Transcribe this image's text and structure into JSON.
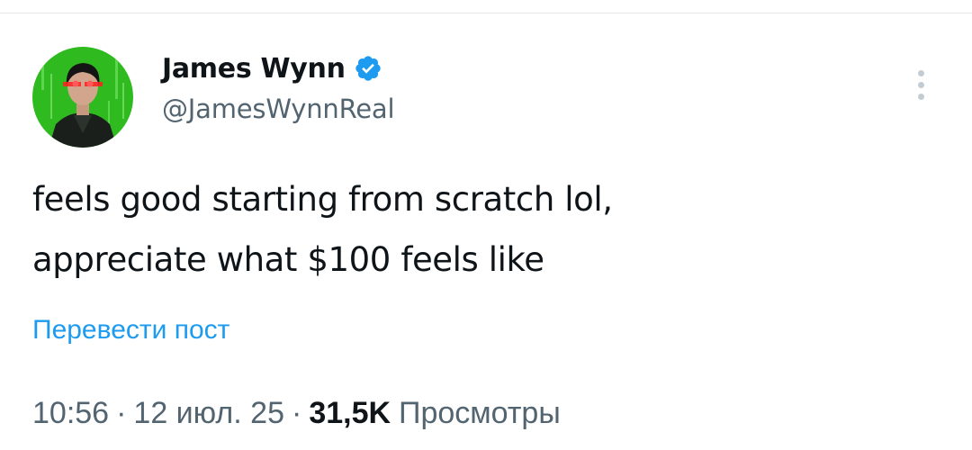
{
  "tweet": {
    "author": {
      "display_name": "James Wynn",
      "handle": "@JamesWynnReal",
      "verified": true,
      "verified_color": "#1d9bf0"
    },
    "text_lines": [
      "feels good starting from scratch lol,",
      "appreciate what $100 feels like"
    ],
    "translate_label": "Перевести пост",
    "meta": {
      "time": "10:56",
      "separator": "·",
      "date": "12 июл. 25",
      "views_count": "31,5K",
      "views_label": "Просмотры"
    }
  },
  "icons": {
    "verified": "verified-badge-icon",
    "more": "more-options-icon"
  },
  "colors": {
    "text_primary": "#0f1419",
    "text_secondary": "#536471",
    "link": "#1d9bf0",
    "avatar_background": "#2fbb20"
  }
}
